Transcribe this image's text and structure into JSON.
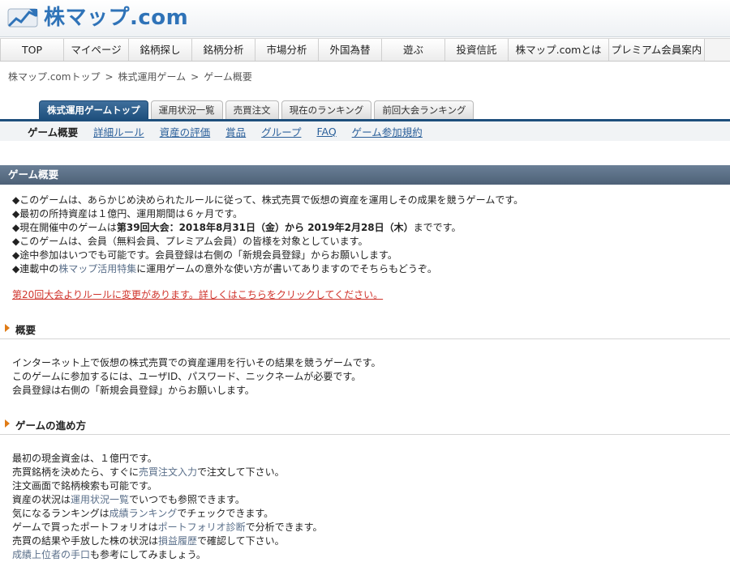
{
  "header": {
    "logo_text": "株マップ.com"
  },
  "gnav": [
    {
      "label": "TOP",
      "w": 79
    },
    {
      "label": "マイページ",
      "w": 80
    },
    {
      "label": "銘柄探し",
      "w": 78
    },
    {
      "label": "銘柄分析",
      "w": 78
    },
    {
      "label": "市場分析",
      "w": 78
    },
    {
      "label": "外国為替",
      "w": 78
    },
    {
      "label": "遊ぶ",
      "w": 78
    },
    {
      "label": "投資信託",
      "w": 78
    },
    {
      "label": "株マップ.comとは",
      "w": 124
    },
    {
      "label": "プレミアム会員案内",
      "w": 118
    }
  ],
  "breadcrumb": {
    "items": [
      "株マップ.comトップ",
      "株式運用ゲーム",
      "ゲーム概要"
    ],
    "sep": ">"
  },
  "tabs": [
    "株式運用ゲームトップ",
    "運用状況一覧",
    "売買注文",
    "現在のランキング",
    "前回大会ランキング"
  ],
  "subnav": {
    "current": "ゲーム概要",
    "links": [
      "詳細ルール",
      "資産の評価",
      "賞品",
      "グループ",
      "FAQ",
      "ゲーム参加規約"
    ]
  },
  "section_title": "ゲーム概要",
  "bullets": {
    "b1": "◆このゲームは、あらかじめ決められたルールに従って、株式売買で仮想の資産を運用しその成果を競うゲームです。",
    "b2": "◆最初の所持資産は１億円、運用期間は６ヶ月です。",
    "b3_pre": "◆現在開催中のゲームは",
    "b3_bold": "第39回大会：2018年8月31日（金）から 2019年2月28日（木）",
    "b3_post": "までです。",
    "b4": "◆このゲームは、会員（無料会員、プレミアム会員）の皆様を対象としています。",
    "b5": "◆途中参加はいつでも可能です。会員登録は右側の「新規会員登録」からお願いします。",
    "b6_pre": "◆連載中の",
    "b6_link": "株マップ活用特集",
    "b6_post": "に運用ゲームの意外な使い方が書いてありますのでそちらもどうぞ。"
  },
  "notice": "第20回大会よりルールに変更があります。詳しくはこちらをクリックしてください。",
  "overview": {
    "title": "概要",
    "lines": [
      "インターネット上で仮想の株式売買での資産運用を行いその結果を競うゲームです。",
      "このゲームに参加するには、ユーザID、パスワード、ニックネームが必要です。",
      "会員登録は右側の「新規会員登録」からお願いします。"
    ]
  },
  "howto": {
    "title": "ゲームの進め方",
    "l1": "最初の現金資金は、１億円です。",
    "l2_pre": "売買銘柄を決めたら、すぐに",
    "l2_link": "売買注文入力",
    "l2_post": "で注文して下さい。",
    "l3": "注文画面で銘柄検索も可能です。",
    "l4_pre": "資産の状況は",
    "l4_link": "運用状況一覧",
    "l4_post": "でいつでも参照できます。",
    "l5_pre": "気になるランキングは",
    "l5_link": "成績ランキング",
    "l5_post": "でチェックできます。",
    "l6_pre": "ゲームで買ったポートフォリオは",
    "l6_link": "ポートフォリオ診断",
    "l6_post": "で分析できます。",
    "l7_pre": "売買の結果や手放した株の状況は",
    "l7_link": "損益履歴",
    "l7_post": "で確認して下さい。",
    "l8_link": "成績上位者の手口",
    "l8_post": "も参考にしてみましょう。"
  },
  "colors": {
    "brand": "#2f73b8",
    "tab_active": "#1e4f7c",
    "section_bar": "#5a6e84",
    "notice_red": "#d0342c",
    "arrow_orange": "#e07b16",
    "link_gray_blue": "#5a6f8a"
  }
}
